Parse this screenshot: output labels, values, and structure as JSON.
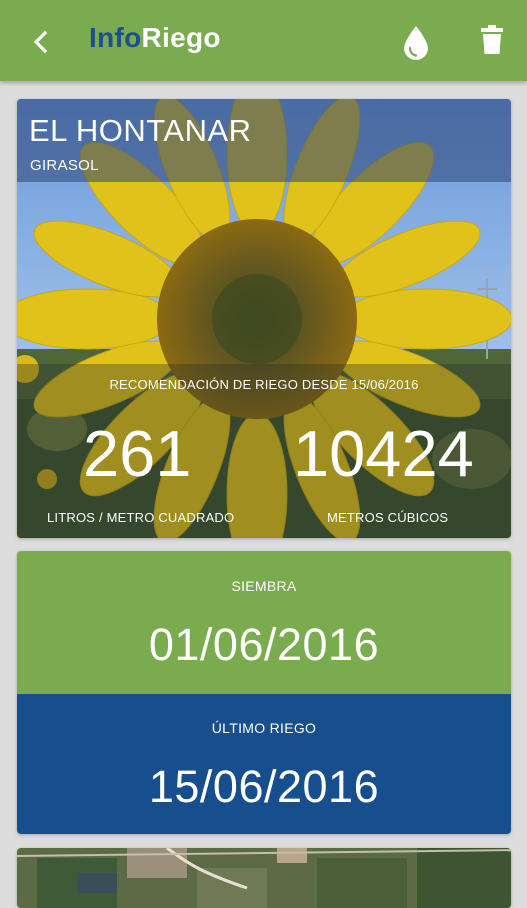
{
  "app_bar": {
    "title_part1": "Info",
    "title_part2": "Riego",
    "back_icon": "arrow-back-icon",
    "water_icon": "water-drop-icon",
    "delete_icon": "trash-icon"
  },
  "plot_card": {
    "field_name": "EL HONTANAR",
    "crop": "GIRASOL",
    "recommendation_label": "RECOMENDACIÓN DE RIEGO DESDE 15/06/2016",
    "liters_value": "261",
    "liters_unit": "LITROS / METRO CUADRADO",
    "cubic_value": "10424",
    "cubic_unit": "METROS CÚBICOS"
  },
  "dates_card": {
    "sowing_label": "SIEMBRA",
    "sowing_date": "01/06/2016",
    "last_irrigation_label": "ÚLTIMO RIEGO",
    "last_irrigation_date": "15/06/2016"
  },
  "colors": {
    "green": "#7aab4e",
    "blue": "#174e8d",
    "brand_blue": "#1c4f8f"
  }
}
